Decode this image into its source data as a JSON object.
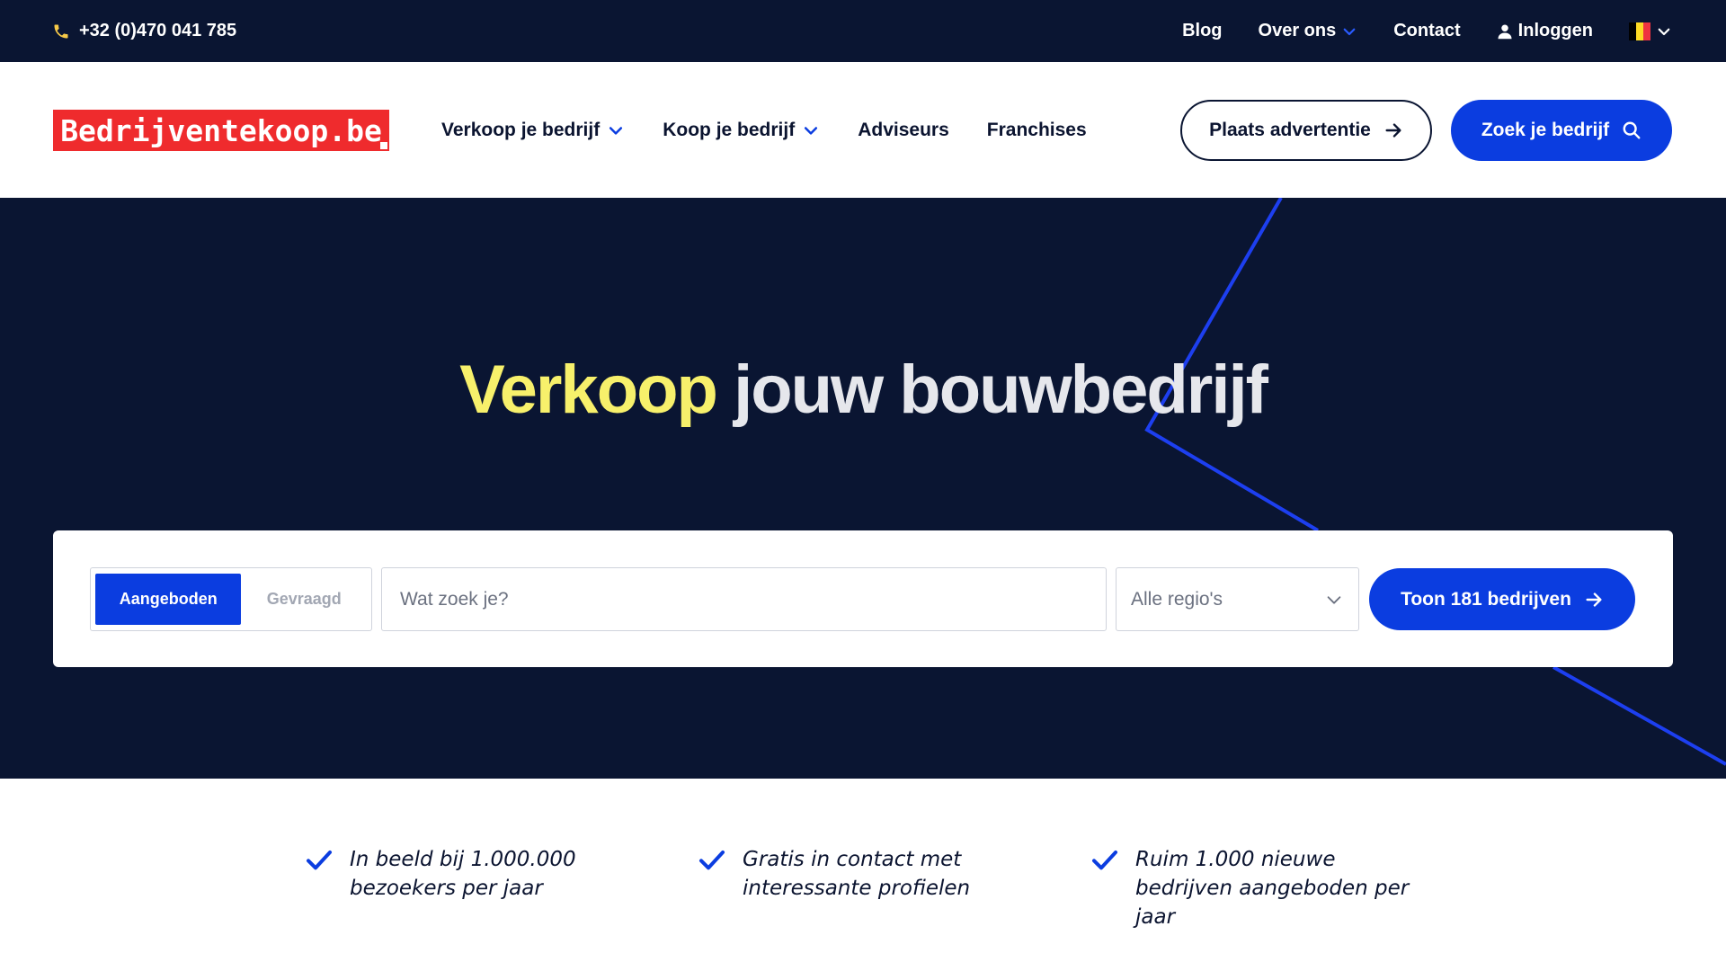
{
  "topbar": {
    "phone": "+32 (0)470 041 785",
    "nav": [
      {
        "label": "Blog"
      },
      {
        "label": "Over ons"
      },
      {
        "label": "Contact"
      },
      {
        "label": "Inloggen"
      }
    ],
    "flag_colors": [
      "#000000",
      "#fdda24",
      "#ef3340"
    ]
  },
  "header": {
    "logo_text": "Bedrijventekoop.be",
    "nav": [
      {
        "label": "Verkoop je bedrijf"
      },
      {
        "label": "Koop je bedrijf"
      },
      {
        "label": "Adviseurs"
      },
      {
        "label": "Franchises"
      }
    ],
    "place_ad_label": "Plaats advertentie",
    "find_business_label": "Zoek je bedrijf"
  },
  "hero": {
    "title_highlight": "Verkoop",
    "title_rest": "jouw bouwbedrijf"
  },
  "search": {
    "tab_active": "Aangeboden",
    "tab_inactive": "Gevraagd",
    "placeholder": "Wat zoek je?",
    "region": "Alle regio's",
    "submit_label": "Toon 181 bedrijven"
  },
  "features": [
    {
      "text": "In beeld bij 1.000.000 bezoekers per jaar"
    },
    {
      "text": "Gratis in contact met interessante profielen"
    },
    {
      "text": "Ruim 1.000 nieuwe bedrijven aangeboden per jaar"
    }
  ],
  "colors": {
    "navy": "#0a1532",
    "primary": "#0b3de0",
    "highlight": "#f7f06b",
    "logo_red": "#ef2b2d"
  }
}
